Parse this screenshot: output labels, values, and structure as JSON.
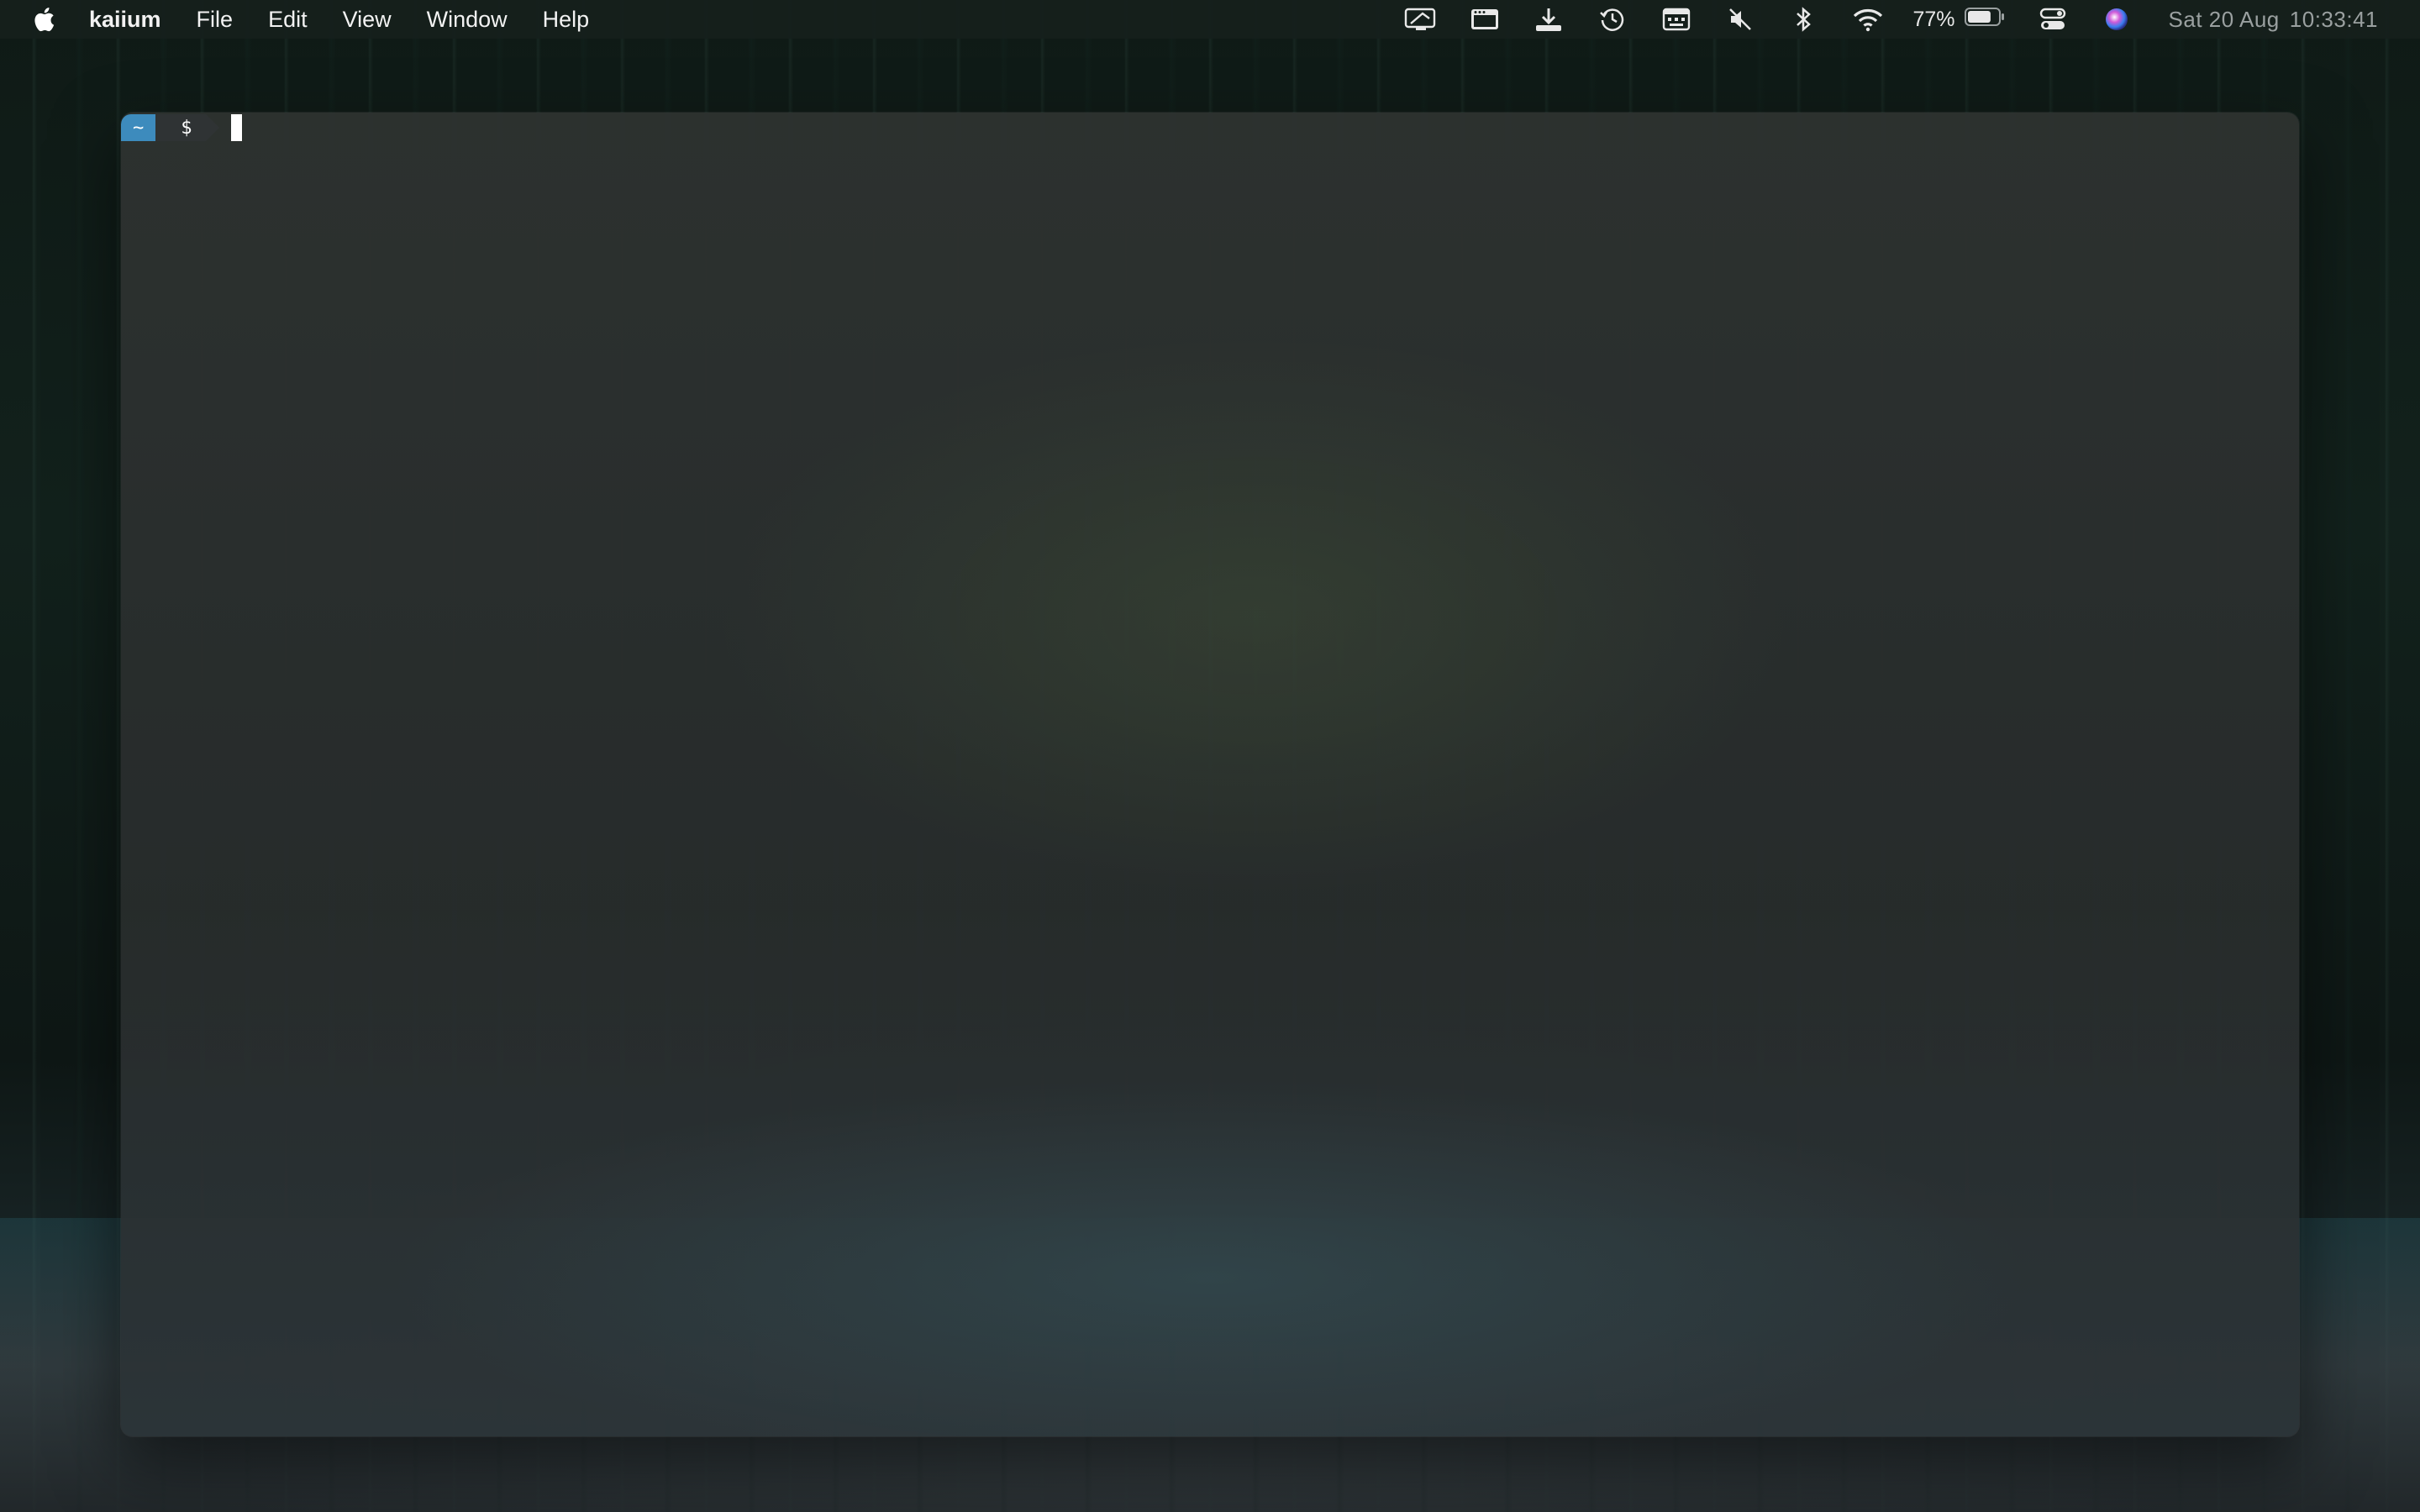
{
  "menubar": {
    "app_name": "kaiium",
    "items": [
      "File",
      "Edit",
      "View",
      "Window",
      "Help"
    ],
    "tray_icons": [
      "screen-share-icon",
      "window-icon",
      "download-icon",
      "time-machine-icon",
      "keyboard-viewer-icon",
      "sound-muted-icon",
      "bluetooth-icon",
      "wifi-icon"
    ],
    "battery_percent": "77%",
    "battery_level": 0.77,
    "clock": {
      "date": "Sat 20 Aug",
      "time": "10:33:41"
    }
  },
  "terminal": {
    "prompt_dir": "~",
    "prompt_symbol": "$",
    "input": ""
  },
  "colors": {
    "prompt_dir_bg": "#3d8bbd",
    "prompt_symbol_bg": "#2f3334",
    "menubar_bg": "#16201c"
  }
}
